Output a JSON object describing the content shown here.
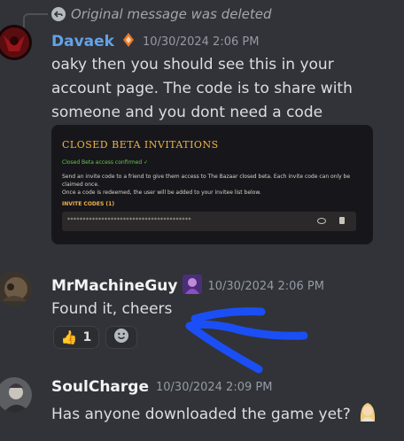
{
  "reply": {
    "text": "Original message was deleted"
  },
  "messages": [
    {
      "author": "Davaek",
      "timestamp": "10/30/2024 2:06 PM",
      "lines": [
        "oaky then you should see this in your",
        "account page. The code is to share with",
        "someone and you dont need a code"
      ],
      "embed": {
        "title": "CLOSED BETA INVITATIONS",
        "status": "Closed Beta access confirmed ✓",
        "description": "Send an invite code to a friend to give them access to The Bazaar closed beta. Each invite code can only be claimed once.",
        "note": "Once a code is redeemed, the user will be added to your invitee list below.",
        "codes_label": "INVITE CODES (1)",
        "code_masked": "****************************************"
      }
    },
    {
      "author": "MrMachineGuy",
      "timestamp": "10/30/2024 2:06 PM",
      "text": "Found it, cheers",
      "reaction": {
        "emoji": "👍",
        "count": "1"
      }
    },
    {
      "author": "SoulCharge",
      "timestamp": "10/30/2024 2:09 PM",
      "text": "Has anyone downloaded the game yet?"
    }
  ],
  "colors": {
    "background": "#313338",
    "name_blue": "#64a2e6",
    "name_white": "#f2f3f5",
    "arrow": "#1b4ff5",
    "embed_gold": "#f0b34a"
  },
  "icons": [
    "reply-arrow-icon",
    "rank-badge-icon",
    "avatar-badge-icon",
    "thumbs-up-emoji",
    "add-reaction-icon",
    "eye-icon",
    "trash-icon",
    "blond-emoji"
  ]
}
